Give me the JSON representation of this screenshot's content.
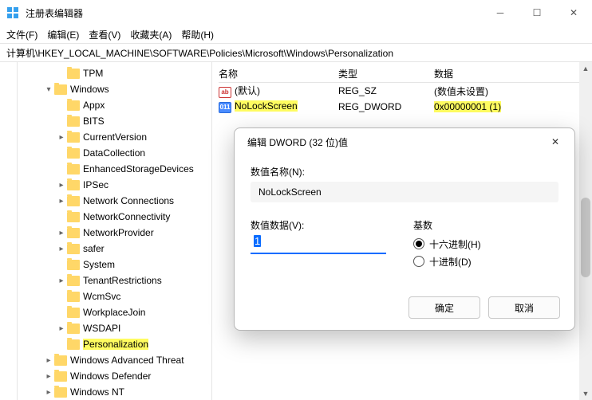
{
  "title": "注册表编辑器",
  "menus": {
    "file": "文件(F)",
    "edit": "编辑(E)",
    "view": "查看(V)",
    "fav": "收藏夹(A)",
    "help": "帮助(H)"
  },
  "address": "计算机\\HKEY_LOCAL_MACHINE\\SOFTWARE\\Policies\\Microsoft\\Windows\\Personalization",
  "tree": [
    {
      "indent": 3,
      "tw": "",
      "label": "TPM"
    },
    {
      "indent": 2,
      "tw": "▾",
      "label": "Windows"
    },
    {
      "indent": 3,
      "tw": "",
      "label": "Appx"
    },
    {
      "indent": 3,
      "tw": "",
      "label": "BITS"
    },
    {
      "indent": 3,
      "tw": "▸",
      "label": "CurrentVersion"
    },
    {
      "indent": 3,
      "tw": "",
      "label": "DataCollection"
    },
    {
      "indent": 3,
      "tw": "",
      "label": "EnhancedStorageDevices"
    },
    {
      "indent": 3,
      "tw": "▸",
      "label": "IPSec"
    },
    {
      "indent": 3,
      "tw": "▸",
      "label": "Network Connections"
    },
    {
      "indent": 3,
      "tw": "",
      "label": "NetworkConnectivity"
    },
    {
      "indent": 3,
      "tw": "▸",
      "label": "NetworkProvider"
    },
    {
      "indent": 3,
      "tw": "▸",
      "label": "safer"
    },
    {
      "indent": 3,
      "tw": "",
      "label": "System"
    },
    {
      "indent": 3,
      "tw": "▸",
      "label": "TenantRestrictions"
    },
    {
      "indent": 3,
      "tw": "",
      "label": "WcmSvc"
    },
    {
      "indent": 3,
      "tw": "",
      "label": "WorkplaceJoin"
    },
    {
      "indent": 3,
      "tw": "▸",
      "label": "WSDAPI"
    },
    {
      "indent": 3,
      "tw": "",
      "label": "Personalization",
      "highlight": true
    },
    {
      "indent": 2,
      "tw": "▸",
      "label": "Windows Advanced Threat"
    },
    {
      "indent": 2,
      "tw": "▸",
      "label": "Windows Defender"
    },
    {
      "indent": 2,
      "tw": "▸",
      "label": "Windows NT"
    }
  ],
  "list": {
    "headers": {
      "name": "名称",
      "type": "类型",
      "data": "数据"
    },
    "rows": [
      {
        "ico": "str",
        "name": "(默认)",
        "type": "REG_SZ",
        "data": "(数值未设置)",
        "highlight": false
      },
      {
        "ico": "dw",
        "name": "NoLockScreen",
        "type": "REG_DWORD",
        "data": "0x00000001 (1)",
        "highlight": true
      }
    ]
  },
  "dialog": {
    "title": "编辑 DWORD (32 位)值",
    "name_label": "数值名称(N):",
    "name_value": "NoLockScreen",
    "data_label": "数值数据(V):",
    "data_value": "1",
    "radix_label": "基数",
    "radix_hex": "十六进制(H)",
    "radix_dec": "十进制(D)",
    "ok": "确定",
    "cancel": "取消"
  }
}
